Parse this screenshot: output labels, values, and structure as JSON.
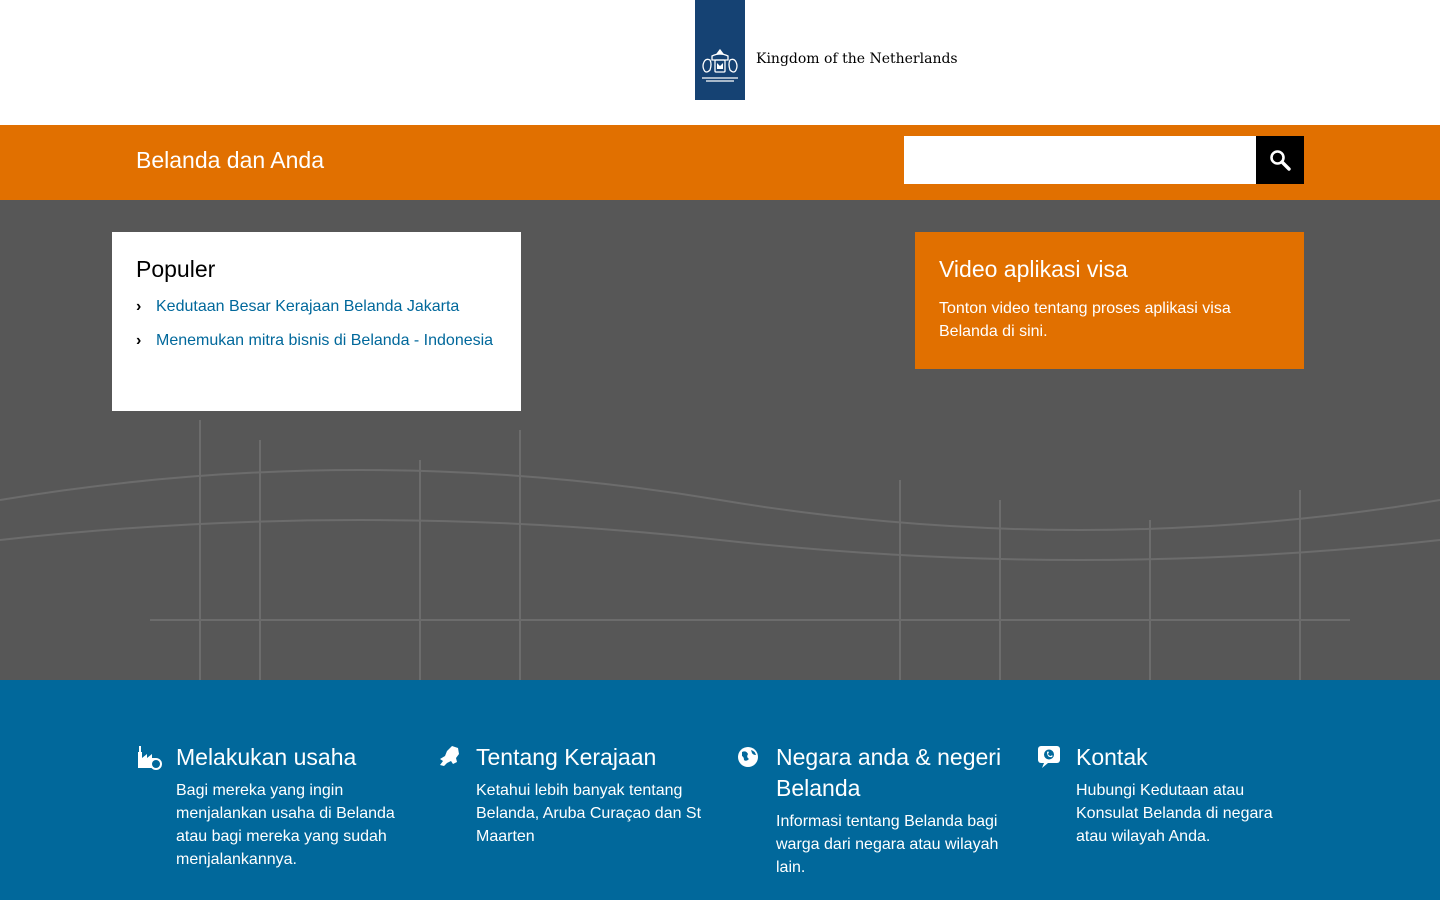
{
  "header": {
    "logo_text": "Kingdom of the Netherlands"
  },
  "nav": {
    "site_title": "Belanda dan Anda",
    "search": {
      "value": "",
      "placeholder": ""
    }
  },
  "popular": {
    "title": "Populer",
    "items": [
      {
        "label": "Kedutaan Besar Kerajaan Belanda Jakarta"
      },
      {
        "label": "Menemukan mitra bisnis di Belanda - Indonesia"
      }
    ]
  },
  "visa_card": {
    "title": "Video aplikasi visa",
    "description": "Tonton video tentang proses aplikasi visa Belanda di sini."
  },
  "features": [
    {
      "icon": "business-icon",
      "title": "Melakukan usaha",
      "description": "Bagi mereka yang ingin menjalankan usaha di Belanda atau bagi mereka yang sudah menjalankannya."
    },
    {
      "icon": "netherlands-map-icon",
      "title": "Tentang Kerajaan",
      "description": "Ketahui lebih banyak tentang Belanda, Aruba Curaçao dan St Maarten"
    },
    {
      "icon": "globe-icon",
      "title": "Negara anda & negeri Belanda",
      "description": "Informasi tentang Belanda bagi warga dari negara atau wilayah lain."
    },
    {
      "icon": "contact-icon",
      "title": "Kontak",
      "description": "Hubungi Kedutaan atau Konsulat Belanda di negara atau wilayah Anda."
    }
  ],
  "colors": {
    "orange": "#e17000",
    "blue": "#01689b",
    "logo_blue": "#154273",
    "hero_gray": "#575757",
    "link": "#01689b"
  }
}
